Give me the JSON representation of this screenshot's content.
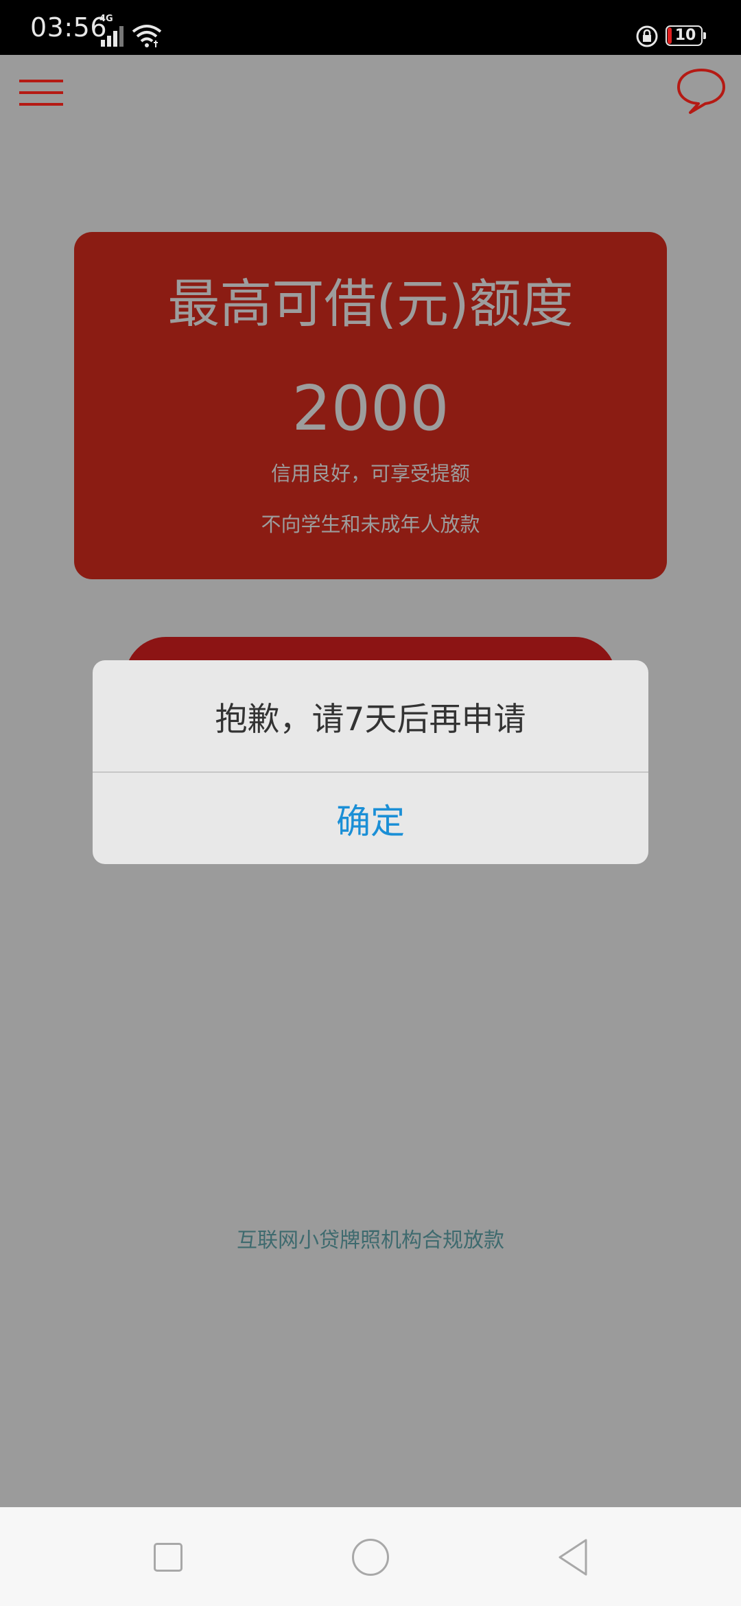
{
  "status_bar": {
    "time": "03:56",
    "network_label": "4G",
    "battery_level": "10",
    "icons": [
      "signal-icon",
      "wifi-icon",
      "rotation-lock-icon",
      "battery-icon"
    ]
  },
  "header": {
    "menu_icon": "hamburger-menu-icon",
    "chat_icon": "chat-bubble-icon",
    "accent_color": "#b51a14"
  },
  "credit_card": {
    "title": "最高可借(元)额度",
    "amount": "2000",
    "subtitle_1": "信用良好，可享受提额",
    "subtitle_2": "不向学生和未成年人放款",
    "background_color": "#8b1c13"
  },
  "dialog": {
    "message": "抱歉，请7天后再申请",
    "confirm_label": "确定",
    "confirm_color": "#1b8fd6"
  },
  "footer": {
    "note": "互联网小贷牌照机构合规放款"
  },
  "nav_bar": {
    "icons": [
      "recent-apps-icon",
      "home-icon",
      "back-icon"
    ]
  }
}
